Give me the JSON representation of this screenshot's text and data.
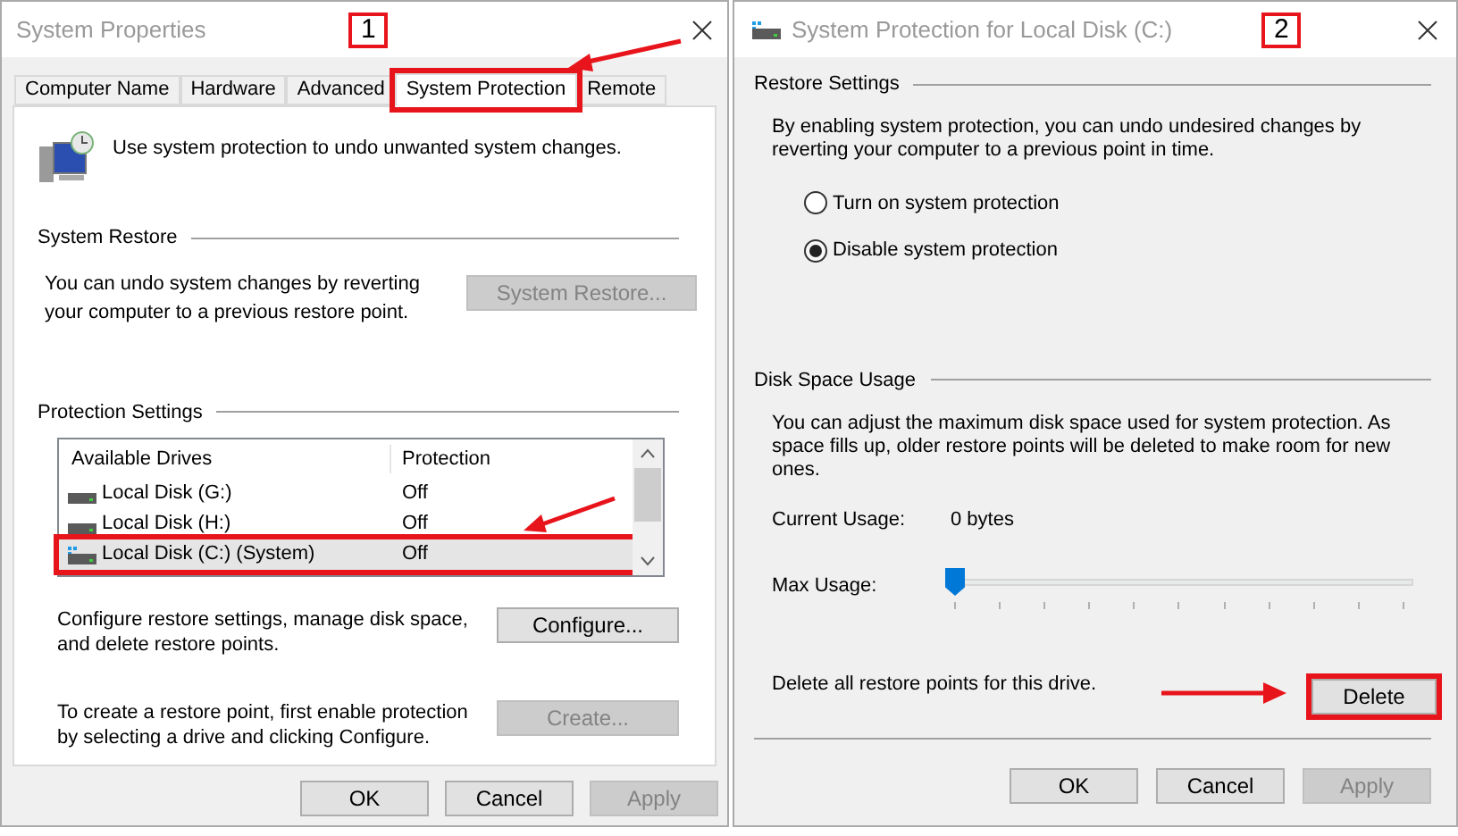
{
  "system_properties": {
    "title": "System Properties",
    "annotation": "1",
    "tabs": [
      {
        "label": "Computer Name",
        "selected": false,
        "highlighted": false
      },
      {
        "label": "Hardware",
        "selected": false,
        "highlighted": false
      },
      {
        "label": "Advanced",
        "selected": false,
        "highlighted": false
      },
      {
        "label": "System Protection",
        "selected": true,
        "highlighted": true
      },
      {
        "label": "Remote",
        "selected": false,
        "highlighted": false
      }
    ],
    "intro": "Use system protection to undo unwanted system changes.",
    "system_restore": {
      "heading": "System Restore",
      "text": "You can undo system changes by reverting your computer to a previous restore point.",
      "button": {
        "label": "System Restore...",
        "disabled": true
      }
    },
    "protection_settings": {
      "heading": "Protection Settings",
      "columns": [
        "Available Drives",
        "Protection"
      ],
      "drives": [
        {
          "name": "Local Disk (G:)",
          "protection": "Off",
          "kind": "drive",
          "selected": false,
          "highlighted": false
        },
        {
          "name": "Local Disk (H:)",
          "protection": "Off",
          "kind": "drive",
          "selected": false,
          "highlighted": false
        },
        {
          "name": "Local Disk (C:) (System)",
          "protection": "Off",
          "kind": "system",
          "selected": true,
          "highlighted": true
        }
      ],
      "configure": {
        "text": "Configure restore settings, manage disk space, and delete restore points.",
        "button": {
          "label": "Configure...",
          "disabled": false
        }
      },
      "create": {
        "text": "To create a restore point, first enable protection by selecting a drive and clicking Configure.",
        "button": {
          "label": "Create...",
          "disabled": true
        }
      }
    },
    "buttons": [
      {
        "label": "OK",
        "disabled": false
      },
      {
        "label": "Cancel",
        "disabled": false
      },
      {
        "label": "Apply",
        "disabled": true
      }
    ]
  },
  "local_disk_protection": {
    "title": "System Protection for Local Disk (C:)",
    "annotation": "2",
    "restore_settings": {
      "heading": "Restore Settings",
      "text": "By enabling system protection, you can undo undesired changes by reverting your computer to a previous point in time.",
      "options": [
        {
          "label": "Turn on system protection",
          "selected": false
        },
        {
          "label": "Disable system protection",
          "selected": true
        }
      ]
    },
    "disk_space_usage": {
      "heading": "Disk Space Usage",
      "text": "You can adjust the maximum disk space used for system protection. As space fills up, older restore points will be deleted to make room for new ones.",
      "current_usage_label": "Current Usage:",
      "current_usage": "0 bytes",
      "max_usage_label": "Max Usage:",
      "max_usage": {
        "level": 0
      }
    },
    "delete": {
      "text": "Delete all restore points for this drive.",
      "button": {
        "label": "Delete",
        "disabled": false,
        "highlighted": true
      }
    },
    "buttons": [
      {
        "label": "OK",
        "disabled": false
      },
      {
        "label": "Cancel",
        "disabled": false
      },
      {
        "label": "Apply",
        "disabled": true
      }
    ]
  }
}
